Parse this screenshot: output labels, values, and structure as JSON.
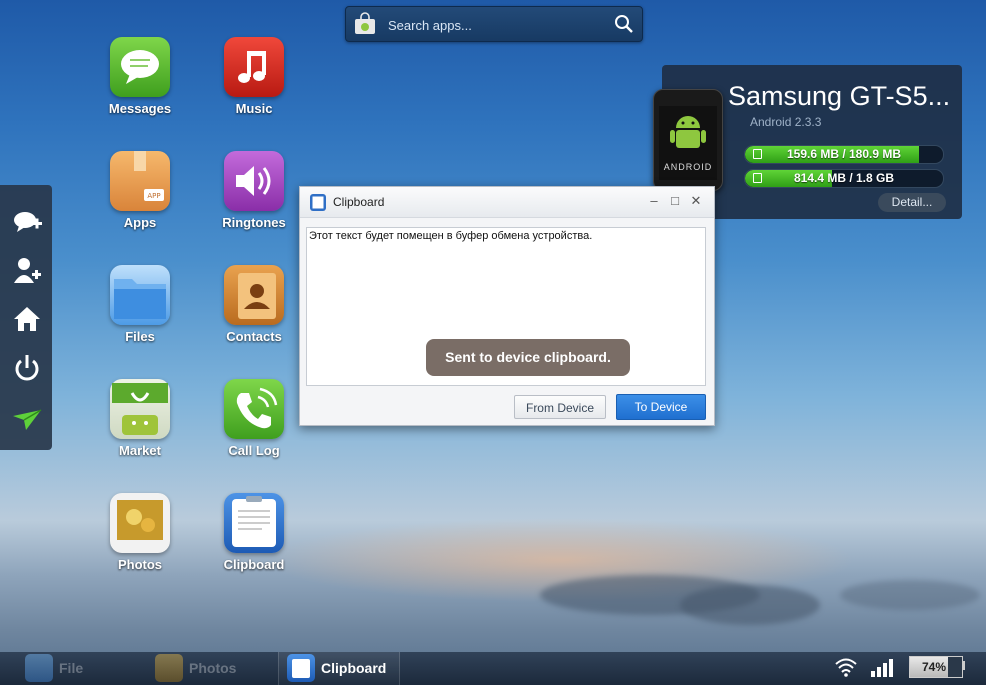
{
  "search": {
    "placeholder": "Search apps..."
  },
  "apps": [
    {
      "label": "Messages"
    },
    {
      "label": "Music"
    },
    {
      "label": "Apps"
    },
    {
      "label": "Ringtones"
    },
    {
      "label": "Files"
    },
    {
      "label": "Contacts"
    },
    {
      "label": "Market"
    },
    {
      "label": "Call Log"
    },
    {
      "label": "Photos"
    },
    {
      "label": "Clipboard"
    }
  ],
  "apps_badge": "APP",
  "sidebar": {
    "icons": [
      "add-comment-icon",
      "add-contact-icon",
      "home-icon",
      "power-icon",
      "send-icon"
    ]
  },
  "device": {
    "name": "Samsung GT-S5...",
    "android": "Android 2.3.3",
    "phone_label": "ANDROID",
    "memory": {
      "text": "159.6 MB / 180.9 MB",
      "used_fraction": 0.88
    },
    "sdcard": {
      "text": "814.4 MB / 1.8 GB",
      "used_fraction": 0.44
    },
    "detail_label": "Detail..."
  },
  "clipboard_dialog": {
    "title": "Clipboard",
    "text": "Этот текст будет помещен в буфер обмена устройства.",
    "toast": "Sent to device clipboard.",
    "from_device": "From Device",
    "to_device": "To Device"
  },
  "taskbar": {
    "items": [
      {
        "label": "File",
        "active": false
      },
      {
        "label": "Photos",
        "active": false
      },
      {
        "label": "Clipboard",
        "active": true
      }
    ],
    "battery": "74%",
    "battery_fraction": 0.74
  },
  "colors": {
    "accent": "#1f6fd0",
    "storage_green": "#3fb51f",
    "toast": "#7a6d66"
  }
}
